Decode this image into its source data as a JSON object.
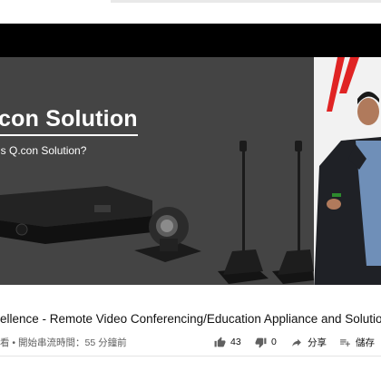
{
  "video": {
    "slide_title": "con Solution",
    "slide_subtitle": "is Q.con Solution?",
    "title": "ellence - Remote Video Conferencing/Education Appliance and Solution",
    "stats": "看 • 開始串流時間：55 分鐘前"
  },
  "actions": {
    "like_count": "43",
    "dislike_count": "0",
    "share_label": "分享",
    "save_label": "儲存"
  },
  "icons": {
    "like": "thumbs-up-icon",
    "dislike": "thumbs-down-icon",
    "share": "share-icon",
    "save": "playlist-add-icon"
  }
}
